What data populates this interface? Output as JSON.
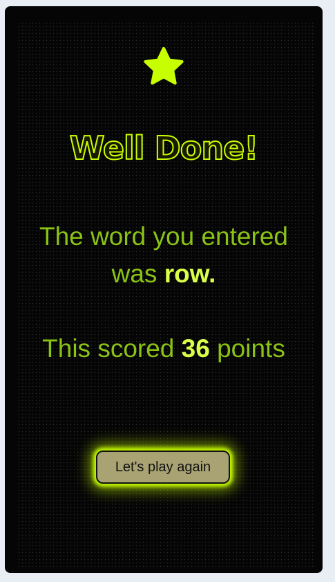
{
  "icons": {
    "top": "star-icon"
  },
  "colors": {
    "accent": "#c8ff00",
    "text_green": "#8bc315",
    "highlight": "#d9ff4a",
    "button_bg": "#a9a374",
    "card_bg": "#050505"
  },
  "result": {
    "title": "Well Done!",
    "word_prefix": "The word you entered was ",
    "word": "row.",
    "score_prefix": "This scored ",
    "score": "36",
    "score_suffix": " points"
  },
  "button": {
    "label": "Let's play again"
  }
}
